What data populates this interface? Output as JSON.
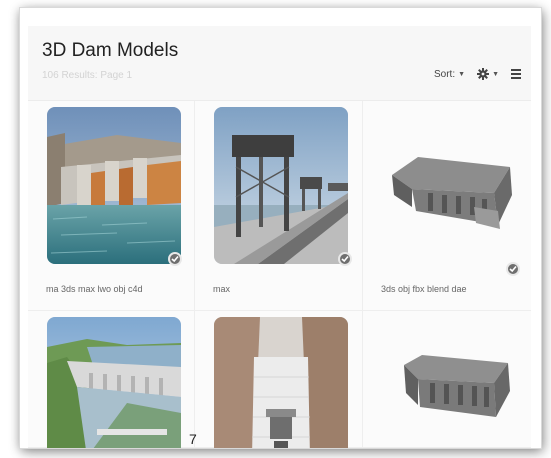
{
  "header": {
    "title": "3D Dam Models",
    "results": "106 Results: Page 1",
    "sort_label": "Sort:",
    "sort_icon": "caret-down-icon",
    "settings_icon": "gear-icon",
    "view_icon": "list-view-icon"
  },
  "models": [
    {
      "formats": "ma 3ds max lwo obj c4d",
      "verified": true
    },
    {
      "formats": "max",
      "verified": true
    },
    {
      "formats": "3ds obj fbx blend dae",
      "verified": true
    },
    {
      "formats": "",
      "verified": false
    },
    {
      "formats": "",
      "verified": false
    },
    {
      "formats": "",
      "verified": false
    }
  ],
  "page_number": "7"
}
